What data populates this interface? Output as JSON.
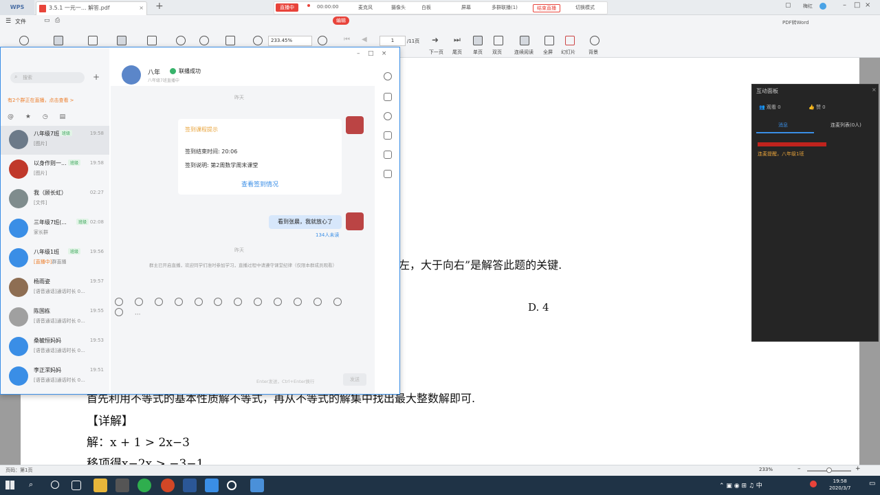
{
  "titlebar": {
    "app": "WPS",
    "doc_tab": "3.5.1 一元一... 解答.pdf",
    "new_tab": "+",
    "live": {
      "status": "直播中",
      "timer": "00:00:00",
      "mic": "麦克风",
      "camera": "摄像头",
      "whiteboard": "白板",
      "screen": "屏幕",
      "multi": "多群联播(1)",
      "end": "结束直播",
      "switch": "切换模式"
    },
    "user": "梅红"
  },
  "toolbar": {
    "file_menu": "文件",
    "edit_pill": "编辑",
    "zoom": "233.45%",
    "page_current": "1",
    "page_total": "/11页",
    "labels": {
      "next": "下一页",
      "last": "尾页",
      "single": "单页",
      "double": "双页",
      "continuous": "连续阅读",
      "fullscreen": "全屏",
      "slideshow": "幻灯片",
      "background": "背景"
    },
    "right_text": "PDF转Word"
  },
  "document": {
    "line1": "左，大于向右”是解答此题的关键.",
    "option_d": "D. 4",
    "line2": "首先利用不等式的基本性质解不等式，再从不等式的解集中找出最大整数解即可.",
    "heading": "【详解】",
    "jie": "解：x + 1 > 2x−3",
    "yixiang": "移项得x−2x > −3−1"
  },
  "chat": {
    "search_placeholder": "搜索",
    "add": "+",
    "notice": "有2个群正在直播，点击查看 >",
    "conversations": [
      {
        "name": "八年级7班",
        "tag": "班级",
        "time": "19:58",
        "preview": "[图片]"
      },
      {
        "name": "以身作则一...",
        "tag": "班级",
        "time": "19:58",
        "preview": "[图片]"
      },
      {
        "name": "我（顾长虹）",
        "tag": "",
        "time": "02:27",
        "preview": "[文件]"
      },
      {
        "name": "三年级7班(...",
        "tag": "班级",
        "time": "02:08",
        "preview": "家长群"
      },
      {
        "name": "八年级1班",
        "tag": "班级",
        "time": "19:56",
        "preview_prefix": "[直播中]",
        "preview": "群直播"
      },
      {
        "name": "杨雨姿",
        "tag": "",
        "time": "19:57",
        "preview": "[语音通话]通话时长 0..."
      },
      {
        "name": "陈国栋",
        "tag": "",
        "time": "19:55",
        "preview": "[语音通话]通话时长 0..."
      },
      {
        "name": "桑毓恒妈妈",
        "tag": "",
        "time": "19:53",
        "preview": "[语音通话]通话时长 0..."
      },
      {
        "name": "李正潔妈妈",
        "tag": "",
        "time": "19:51",
        "preview": "[语音通话]通话时长 0..."
      }
    ],
    "group_name": "八年",
    "connected": "联播成功",
    "group_sub": "八年级7班直播中",
    "date1": "昨天",
    "card": {
      "title": "签到课程提示",
      "end_time": "签到结束时间: 20:06",
      "desc": "签到说明: 第2周数学周末课堂",
      "button": "查看签到情况"
    },
    "reply": "看到张晨，我就放心了",
    "read": "134人未读",
    "date2": "昨天",
    "system_msg": "群主已开启直播，欢迎同学们准时参加学习，直播过程中请遵守课堂纪律（仅限本群成员观看）",
    "send_hint": "Enter发送，Ctrl+Enter换行",
    "send": "发送"
  },
  "interaction": {
    "title": "互动面板",
    "online": "观看 0",
    "likes": "赞 0",
    "tab_messages": "消息",
    "tab_connect": "连麦列表(0人)",
    "message": "连麦提醒，八年级1班"
  },
  "status": {
    "left": "页码：第1页",
    "zoom": "233%"
  },
  "taskbar": {
    "time": "19:58",
    "date": "2020/3/7"
  }
}
